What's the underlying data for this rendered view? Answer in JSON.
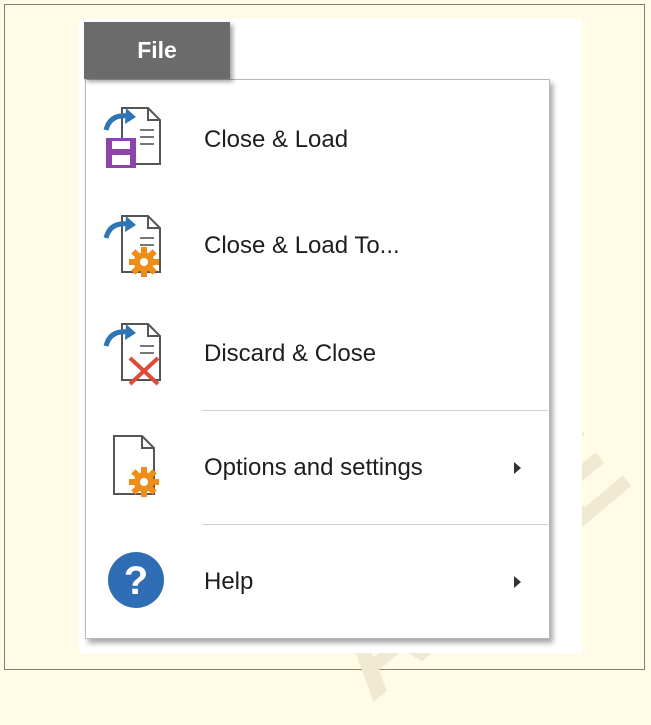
{
  "menu": {
    "tab_label": "File",
    "items": [
      {
        "label": "Close & Load",
        "icon": "close-load-icon"
      },
      {
        "label": "Close & Load To...",
        "icon": "close-load-to-icon"
      },
      {
        "label": "Discard & Close",
        "icon": "discard-close-icon"
      },
      {
        "label": "Options and settings",
        "icon": "options-settings-icon",
        "submenu": true
      },
      {
        "label": "Help",
        "icon": "help-icon",
        "submenu": true
      }
    ]
  },
  "colors": {
    "tab": "#6b6b6b",
    "arrow_blue": "#2e75b6",
    "floppy_purple": "#8e44ad",
    "gear_orange": "#f08c1a",
    "discard_red": "#e04a3a",
    "help_blue": "#2f6db5",
    "background": "#fffbe6"
  }
}
